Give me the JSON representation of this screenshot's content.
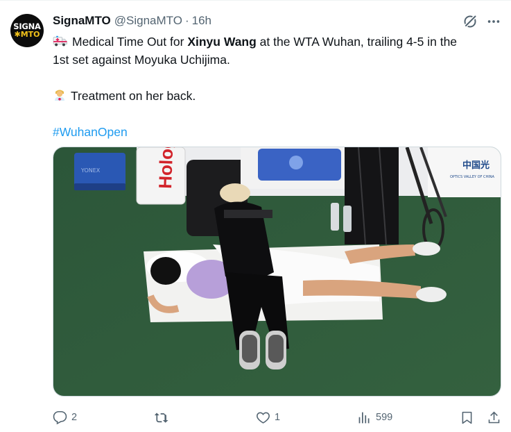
{
  "post": {
    "avatar": {
      "line1": "SIGNA",
      "line2": "MTO"
    },
    "author_name": "SignaMTO",
    "handle": "@SignaMTO",
    "separator": "·",
    "time": "16h",
    "text": {
      "line1_prefix": "Medical Time Out for ",
      "player_bold": "Xinyu Wang",
      "line1_suffix": " at the WTA Wuhan, trailing 4-5 in the",
      "line2": "1st set against Moyuka Uchijima.",
      "line3": "Treatment on her back.",
      "hashtag": "#WuhanOpen"
    },
    "media_text": {
      "bag_brand": "YONEX",
      "banner_brand": "Hologic",
      "sponsor_cn": "中国光",
      "sponsor_en": "OPTICS VALLEY OF CHINA"
    },
    "actions": {
      "replies": "2",
      "reposts": "",
      "likes": "1",
      "views": "599"
    }
  },
  "colors": {
    "text": "#0f1419",
    "secondary": "#536471",
    "link": "#1d9bf0",
    "court_green": "#2f5a3b"
  },
  "icons": [
    "ambulance-icon",
    "health-worker-icon",
    "grok-icon",
    "more-icon",
    "reply-icon",
    "repost-icon",
    "like-icon",
    "views-icon",
    "bookmark-icon",
    "share-icon"
  ]
}
